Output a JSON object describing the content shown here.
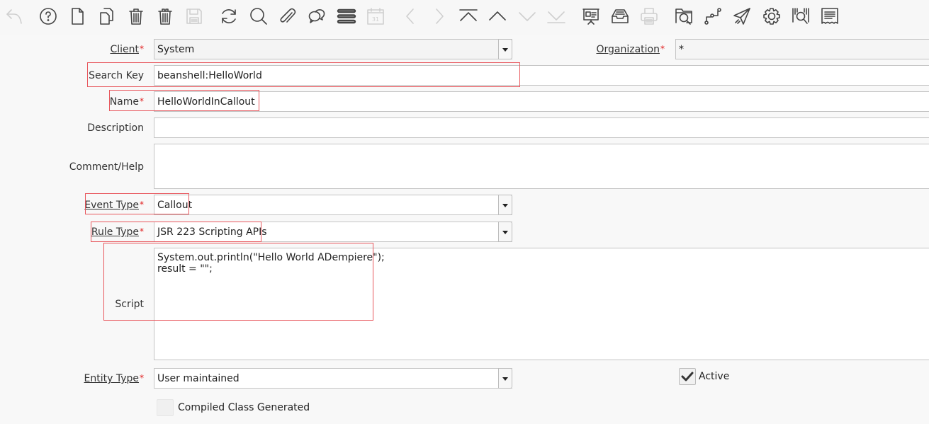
{
  "toolbar": {
    "buttons": [
      {
        "name": "undo",
        "icon": "undo-icon",
        "enabled": false
      },
      {
        "name": "help",
        "icon": "help-icon",
        "enabled": true
      },
      {
        "name": "new",
        "icon": "new-document-icon",
        "enabled": true
      },
      {
        "name": "copy",
        "icon": "copy-icon",
        "enabled": true
      },
      {
        "name": "delete",
        "icon": "trash-icon",
        "enabled": true
      },
      {
        "name": "delete-selection",
        "icon": "trash-multiple-icon",
        "enabled": true
      },
      {
        "name": "save",
        "icon": "save-icon",
        "enabled": false
      },
      {
        "name": "refresh",
        "icon": "refresh-icon",
        "enabled": true
      },
      {
        "name": "find",
        "icon": "search-icon",
        "enabled": true
      },
      {
        "name": "attachment",
        "icon": "paperclip-icon",
        "enabled": true
      },
      {
        "name": "chat",
        "icon": "chat-icon",
        "enabled": true
      },
      {
        "name": "grid-toggle",
        "icon": "list-icon",
        "enabled": true
      },
      {
        "name": "calendar",
        "icon": "calendar-icon",
        "enabled": false
      },
      {
        "name": "previous-record",
        "icon": "chevron-left-icon",
        "enabled": false
      },
      {
        "name": "next-record",
        "icon": "chevron-right-icon",
        "enabled": false
      },
      {
        "name": "first-record",
        "icon": "first-record-icon",
        "enabled": true
      },
      {
        "name": "parent-record",
        "icon": "chevron-up-icon",
        "enabled": true
      },
      {
        "name": "detail-record",
        "icon": "chevron-down-icon",
        "enabled": false
      },
      {
        "name": "last-record",
        "icon": "last-record-icon",
        "enabled": false
      },
      {
        "name": "report",
        "icon": "presentation-icon",
        "enabled": true
      },
      {
        "name": "archive",
        "icon": "inbox-icon",
        "enabled": true
      },
      {
        "name": "print",
        "icon": "printer-icon",
        "enabled": false
      },
      {
        "name": "zoom-across",
        "icon": "folder-search-icon",
        "enabled": true
      },
      {
        "name": "workflow",
        "icon": "workflow-icon",
        "enabled": true
      },
      {
        "name": "request",
        "icon": "send-icon",
        "enabled": true
      },
      {
        "name": "process",
        "icon": "gear-icon",
        "enabled": true
      },
      {
        "name": "product-info",
        "icon": "barcode-search-icon",
        "enabled": true
      },
      {
        "name": "quick-form",
        "icon": "receipt-icon",
        "enabled": true
      }
    ]
  },
  "form": {
    "client": {
      "label": "Client",
      "required": "*",
      "value": "System"
    },
    "organization": {
      "label": "Organization",
      "required": "*",
      "value": "*"
    },
    "search_key": {
      "label": "Search Key",
      "value": "beanshell:HelloWorld"
    },
    "name": {
      "label": "Name",
      "required": "*",
      "value": "HelloWorldInCallout"
    },
    "description": {
      "label": "Description",
      "value": ""
    },
    "comment_help": {
      "label": "Comment/Help",
      "value": ""
    },
    "event_type": {
      "label": "Event Type",
      "required": "*",
      "value": "Callout"
    },
    "rule_type": {
      "label": "Rule Type",
      "required": "*",
      "value": "JSR 223 Scripting APIs"
    },
    "script": {
      "label": "Script",
      "value": "System.out.println(\"Hello World ADempiere\");\nresult = \"\";"
    },
    "entity_type": {
      "label": "Entity Type",
      "required": "*",
      "value": "User maintained"
    },
    "active": {
      "label": "Active",
      "checked": true
    },
    "compiled_class": {
      "label": "Compiled Class Generated",
      "checked": false
    }
  },
  "colors": {
    "highlight": "#e8575d",
    "required": "#e02020"
  }
}
